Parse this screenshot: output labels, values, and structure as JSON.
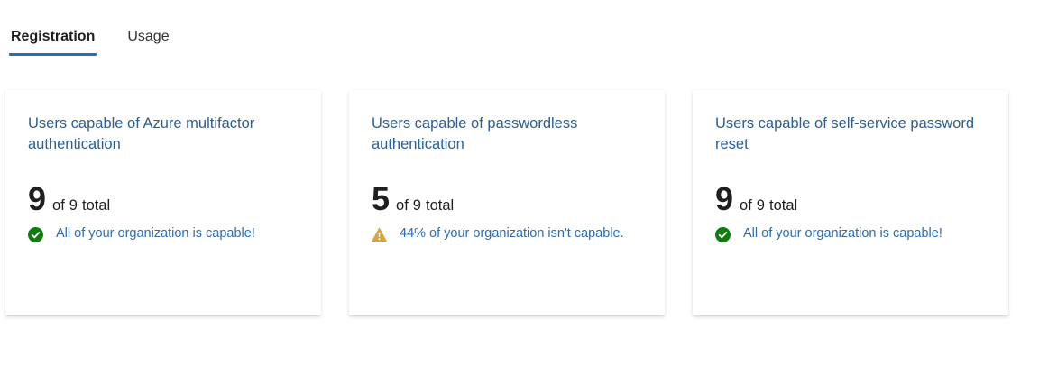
{
  "tabs": [
    {
      "label": "Registration",
      "active": true
    },
    {
      "label": "Usage",
      "active": false
    }
  ],
  "cards": [
    {
      "title": "Users capable of Azure multifactor authentication",
      "count": "9",
      "of_label": "of",
      "total": "9",
      "total_label": "total",
      "status_icon": "check-circle-icon",
      "status_color": "#107c10",
      "status_text": "All of your organization is capable!"
    },
    {
      "title": "Users capable of passwordless authentication",
      "count": "5",
      "of_label": "of",
      "total": "9",
      "total_label": "total",
      "status_icon": "warning-icon",
      "status_color": "#d9a43b",
      "status_text": "44% of your organization isn't capable."
    },
    {
      "title": "Users capable of self-service password reset",
      "count": "9",
      "of_label": "of",
      "total": "9",
      "total_label": "total",
      "status_icon": "check-circle-icon",
      "status_color": "#107c10",
      "status_text": "All of your organization is capable!"
    }
  ],
  "colors": {
    "accent": "#2b6cb5",
    "title_link": "#2b5f95",
    "success": "#107c10",
    "warning": "#d9a43b"
  }
}
